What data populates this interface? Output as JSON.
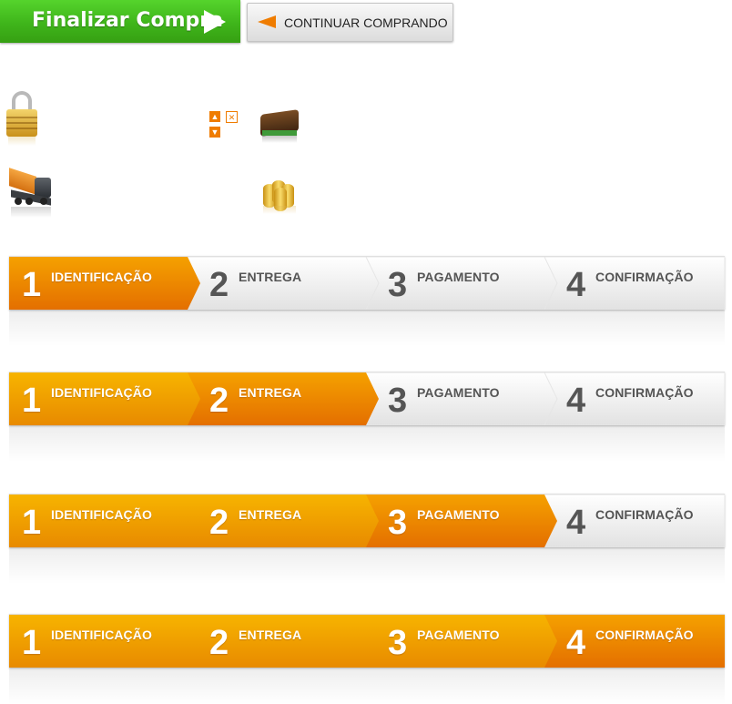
{
  "header": {
    "finalizar_label": "Finalizar Compra",
    "continuar_label": "CONTINUAR COMPRANDO"
  },
  "icons": [
    "lock-icon",
    "sort-icons",
    "wallet-icon",
    "truck-icon",
    "coins-icon"
  ],
  "colors": {
    "green": "#3fb51b",
    "orange": "#ef7c00",
    "orange_light": "#f6b20a",
    "gray_text": "#555555"
  },
  "progress_bars": [
    {
      "active_step": 1,
      "steps": [
        {
          "num": "1",
          "label": "IDENTIFICAÇÃO"
        },
        {
          "num": "2",
          "label": "ENTREGA"
        },
        {
          "num": "3",
          "label": "PAGAMENTO"
        },
        {
          "num": "4",
          "label": "CONFIRMAÇÃO"
        }
      ]
    },
    {
      "active_step": 2,
      "steps": [
        {
          "num": "1",
          "label": "IDENTIFICAÇÃO"
        },
        {
          "num": "2",
          "label": "ENTREGA"
        },
        {
          "num": "3",
          "label": "PAGAMENTO"
        },
        {
          "num": "4",
          "label": "CONFIRMAÇÃO"
        }
      ]
    },
    {
      "active_step": 3,
      "steps": [
        {
          "num": "1",
          "label": "IDENTIFICAÇÃO"
        },
        {
          "num": "2",
          "label": "ENTREGA"
        },
        {
          "num": "3",
          "label": "PAGAMENTO"
        },
        {
          "num": "4",
          "label": "CONFIRMAÇÃO"
        }
      ]
    },
    {
      "active_step": 4,
      "steps": [
        {
          "num": "1",
          "label": "IDENTIFICAÇÃO"
        },
        {
          "num": "2",
          "label": "ENTREGA"
        },
        {
          "num": "3",
          "label": "PAGAMENTO"
        },
        {
          "num": "4",
          "label": "CONFIRMAÇÃO"
        }
      ]
    }
  ]
}
